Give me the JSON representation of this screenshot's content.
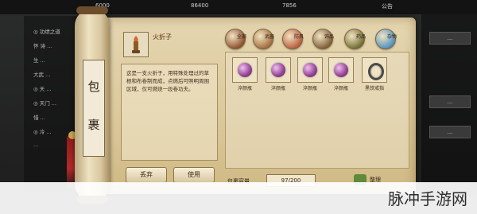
{
  "hud": {
    "coin_1": "6000",
    "coin_2": "86400",
    "coin_3": "7856",
    "right": "公告"
  },
  "left_panel": {
    "lines": [
      "◎ 功绩之道",
      "怀 诗 ...",
      "生 ...",
      "大武 ...",
      "◎ 天 ...",
      "◎ 天门 ...",
      "惜 ...",
      "◎ 冷 ...",
      "..."
    ]
  },
  "right_panel": {
    "buttons": [
      "...",
      "...",
      "..."
    ]
  },
  "bag": {
    "title_chars": [
      "包",
      "裹"
    ],
    "item": {
      "name": "火折子",
      "description": "这是一支火折子，用特殊处理过的草根和布卷制而成，点燃后可照明周围区域，仅可燃烧一段卷功夫。"
    },
    "buttons": {
      "discard": "丢弃",
      "use": "使用"
    },
    "tabs": [
      {
        "label": "全部",
        "color": "#8a4b2a"
      },
      {
        "label": "武器",
        "color": "#a06a3a"
      },
      {
        "label": "防具",
        "color": "#b85a3a"
      },
      {
        "label": "饰品",
        "color": "#7b5b34"
      },
      {
        "label": "药品",
        "color": "#6e6b2e"
      },
      {
        "label": "杂物",
        "color": "#4b8fbf"
      }
    ],
    "grid_items": [
      {
        "label": "淬颜瓶",
        "kind": "gem"
      },
      {
        "label": "淬颜瓶",
        "kind": "gem"
      },
      {
        "label": "淬颜瓶",
        "kind": "gem"
      },
      {
        "label": "淬颜瓶",
        "kind": "gem"
      },
      {
        "label": "黑铁戒指",
        "kind": "ring"
      }
    ],
    "capacity_label": "包裹容量",
    "capacity_value": "97/200",
    "sort_label": "整理"
  },
  "watermark": "脉冲手游网"
}
